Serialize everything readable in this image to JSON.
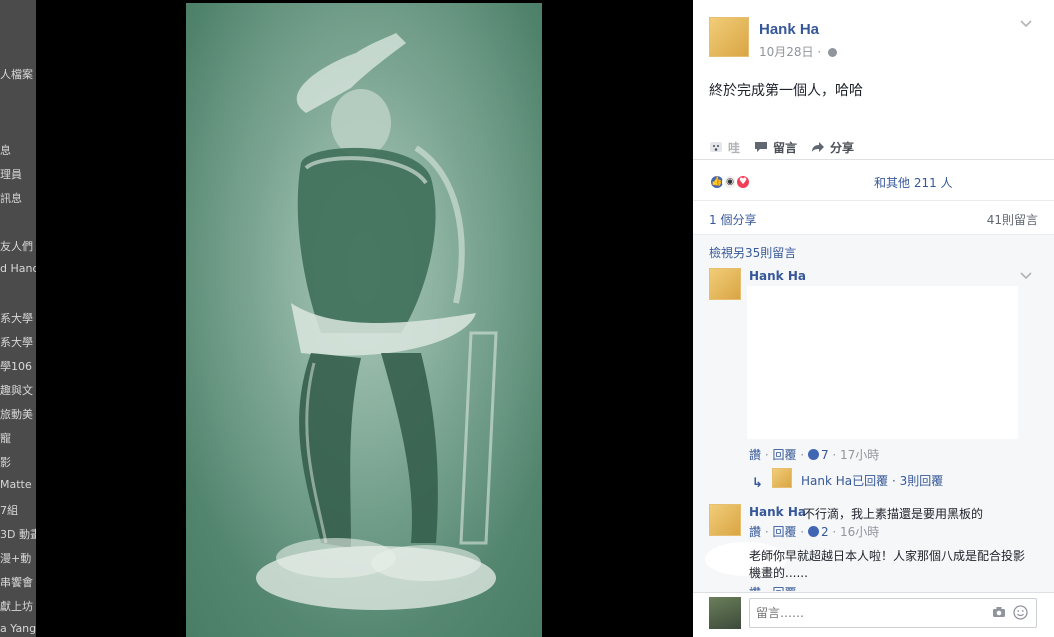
{
  "background_sidebar": {
    "items": [
      "人檔案",
      "息",
      "理員",
      "訊息",
      "友人們",
      "d Hand",
      "系大學",
      "系大學",
      "學106",
      "趣與文",
      "旅動美",
      "寵",
      "影",
      "Matte",
      "7組",
      "3D 動畫",
      "漫+動",
      "串饗會",
      "獻上坊",
      "a Yang"
    ]
  },
  "post": {
    "author": "Hank Ha",
    "date": "10月28日",
    "date_sep": "·",
    "text": "終於完成第一個人，哈哈"
  },
  "actions": {
    "wow": "哇",
    "comment": "留言",
    "share": "分享"
  },
  "reactions": {
    "summary": "和其他 211 人"
  },
  "stats": {
    "shares": "1 個分享",
    "comments": "41則留言"
  },
  "comments": {
    "view_more": "檢視另35則留言",
    "items": [
      {
        "author": "Hank Ha",
        "text": "",
        "like": "讚",
        "reply": "回覆",
        "count": "7",
        "time": "17小時"
      },
      {
        "author": "Hank Ha",
        "text": "不行滴，我上素描還是要用黑板的",
        "like": "讚",
        "reply": "回覆",
        "count": "2",
        "time": "16小時"
      },
      {
        "author": "",
        "text": "老師你早就超越日本人啦！人家那個八成是配合投影機畫的......",
        "like": "讚",
        "reply": "回覆",
        "count": "",
        "time": ""
      }
    ],
    "reply_summary": "Hank Ha已回覆 · 3則回覆"
  },
  "comment_box": {
    "placeholder": "留言……"
  },
  "colors": {
    "link": "#365899",
    "board": "#5f917b",
    "like": "#4267b2",
    "love": "#f33e58"
  }
}
